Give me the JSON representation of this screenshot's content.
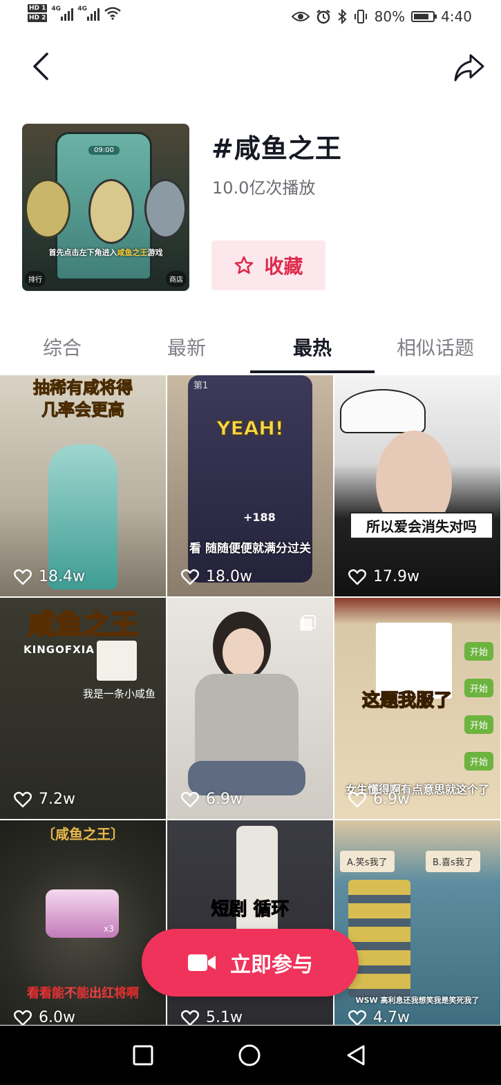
{
  "status_bar": {
    "hd1": "HD 1",
    "hd2": "HD 2",
    "sim1_net": "4G",
    "sim2_net": "4G",
    "battery_text": "80%",
    "battery_level": 0.8,
    "time": "4:40"
  },
  "nav": {
    "back_icon": "chevron-left-icon",
    "share_icon": "share-arrow-icon"
  },
  "topic": {
    "title": "#咸鱼之王",
    "plays": "10.0亿次播放",
    "favorite_label": "收藏",
    "cover": {
      "timer": "09:00",
      "caption_pre": "首先点击左下角进入",
      "caption_highlight": "咸鱼之王",
      "caption_post": "游戏",
      "left_badge": "排行",
      "right_badge": "商店"
    }
  },
  "tabs": [
    {
      "label": "综合"
    },
    {
      "label": "最新"
    },
    {
      "label": "最热",
      "active": true
    },
    {
      "label": "相似话题"
    }
  ],
  "videos": [
    {
      "likes": "18.4w",
      "text": "抽稀有咸将得\n几率会更高"
    },
    {
      "likes": "18.0w",
      "text": "看 随随便便就满分过关",
      "sub": "YEAH!",
      "score": "+188",
      "badge": "第1"
    },
    {
      "likes": "17.9w",
      "text": "所以爱会消失对吗"
    },
    {
      "likes": "7.2w",
      "text": "我是一条小咸鱼",
      "logo": "咸鱼之王",
      "logo_en": "KINGOFXIA"
    },
    {
      "likes": "6.9w"
    },
    {
      "likes": "6.9w",
      "text": "这题我服了",
      "sub": "女生懂得啊有点意思就这个了",
      "buttons": [
        "开始",
        "开始",
        "开始",
        "开始"
      ]
    },
    {
      "likes": "6.0w",
      "text": "看看能不能出红将啊",
      "logo": "〔咸鱼之王〕",
      "mult": "x3"
    },
    {
      "likes": "5.1w",
      "text": "短剧 循环"
    },
    {
      "likes": "4.7w",
      "text": "WSW 高利息还我想笑我是笑死我了",
      "opt_a": "A.笑s我了",
      "opt_b": "B.喜s我了"
    }
  ],
  "join_button": {
    "label": "立即参与",
    "icon": "video-camera-icon"
  },
  "colors": {
    "accent": "#f0335a",
    "favorite_bg": "#fce8ec",
    "favorite_fg": "#e0294c"
  }
}
